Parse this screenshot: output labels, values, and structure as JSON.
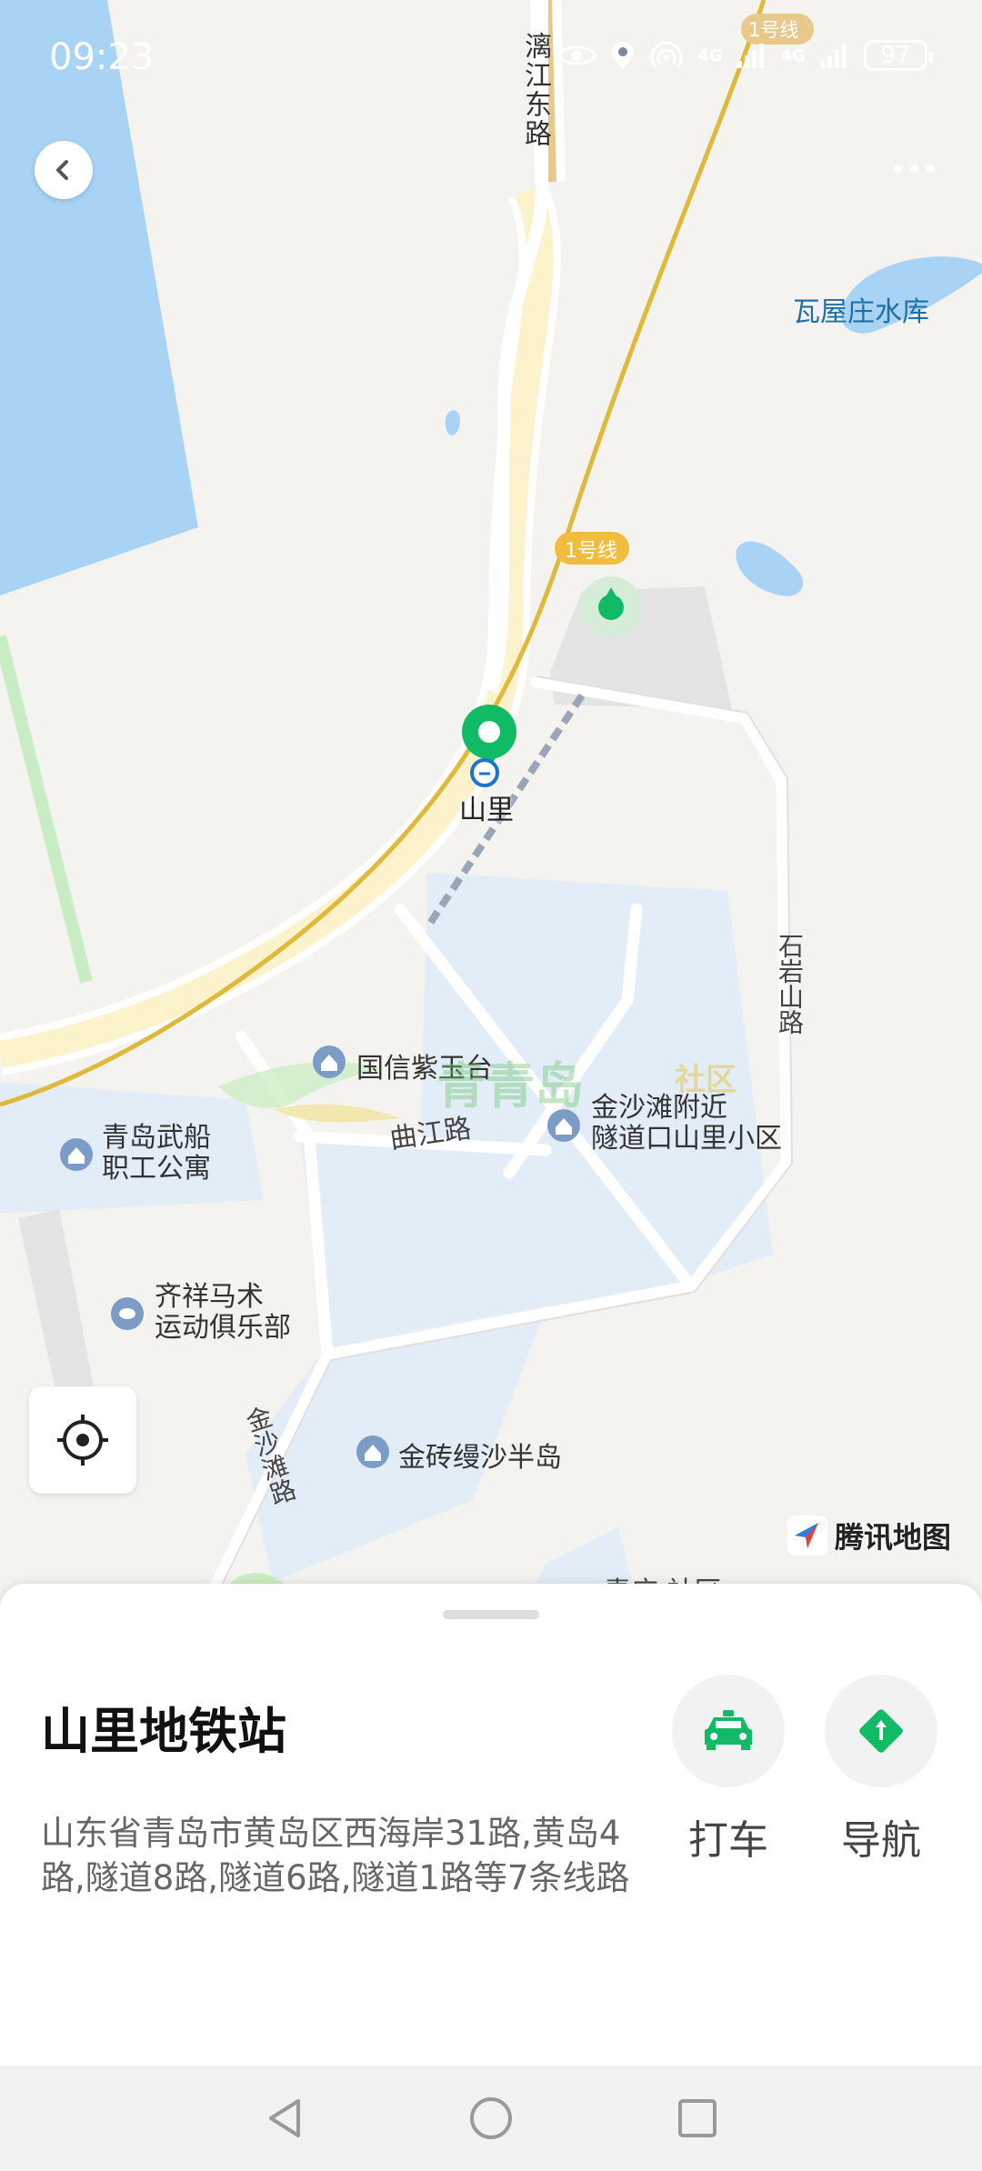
{
  "status_bar": {
    "time": "09:23",
    "battery": "97",
    "net1": "4G",
    "net2": "4G"
  },
  "map": {
    "labels": {
      "lijiang_east_road": "漓江东路",
      "line1_top": "1号线",
      "line1_mid": "1号线",
      "wawu_reservoir": "瓦屋庄水库",
      "shanli": "山里",
      "shiyanshan_road": "石岩山路",
      "guoxin": "国信紫玉台",
      "qujiang_road": "曲江路",
      "jinshatan_line1": "金沙滩附近",
      "jinshatan_line2": "隧道口山里小区",
      "wuchuan_line1": "青岛武船",
      "wuchuan_line2": "职工公寓",
      "qixiang_line1": "齐祥马术",
      "qixiang_line2": "运动俱乐部",
      "jinshatan_road": "金沙滩路",
      "jinzhuan": "金砖缦沙半岛",
      "qingdao_watermark": "青青岛",
      "shequ_watermark": "社区",
      "partial_label": "青庄 社区"
    },
    "brand": "腾讯地图"
  },
  "poi": {
    "name": "山里地铁站",
    "address": "山东省青岛市黄岛区西海岸31路,黄岛4路,隧道8路,隧道6路,隧道1路等7条线路"
  },
  "actions": {
    "taxi": "打车",
    "navigate": "导航"
  },
  "colors": {
    "accent": "#11bb66",
    "water": "#a8d3f5",
    "metro": "#e0b83a"
  }
}
